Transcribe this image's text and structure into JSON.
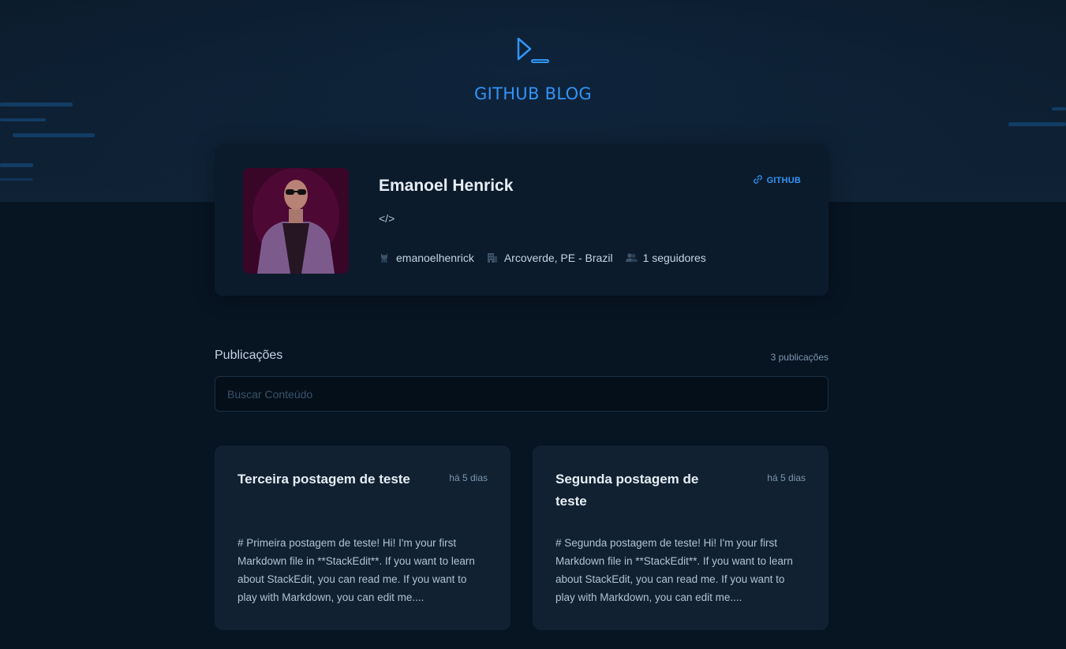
{
  "header": {
    "brand_title": "GITHUB BLOG",
    "brand_icon": "terminal-prompt-icon",
    "accent_color": "#3294F8"
  },
  "profile": {
    "name": "Emanoel Henrick",
    "github_label": "GITHUB",
    "bio": "</>",
    "username": "emanoelhenrick",
    "location": "Arcoverde, PE - Brazil",
    "followers": "1 seguidores"
  },
  "publications": {
    "title": "Publicações",
    "count": "3 publicações",
    "search_placeholder": "Buscar Conteúdo",
    "posts": [
      {
        "title": "Terceira postagem de teste",
        "date": "há 5 dias",
        "excerpt": "# Primeira postagem de teste! Hi! I'm your first Markdown file in **StackEdit**. If you want to learn about StackEdit, you can read me. If you want to play with Markdown, you can edit me...."
      },
      {
        "title": "Segunda postagem de teste",
        "date": "há 5 dias",
        "excerpt": "# Segunda postagem de teste! Hi! I'm your first Markdown file in **StackEdit**. If you want to learn about StackEdit, you can read me. If you want to play with Markdown, you can edit me...."
      }
    ]
  }
}
